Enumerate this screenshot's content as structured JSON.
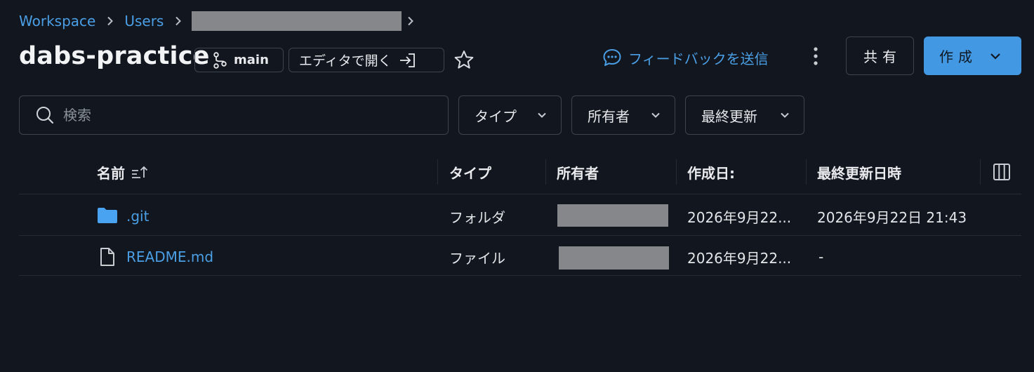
{
  "breadcrumb": {
    "items": [
      "Workspace",
      "Users"
    ]
  },
  "header": {
    "title": "dabs-practice",
    "branch": "main",
    "open_editor": "エディタで開く",
    "feedback": "フィードバックを送信",
    "share": "共有",
    "create": "作成"
  },
  "filters": {
    "search_placeholder": "検索",
    "type": "タイプ",
    "owner": "所有者",
    "last_modified": "最終更新"
  },
  "table": {
    "columns": {
      "name": "名前",
      "type": "タイプ",
      "owner": "所有者",
      "created": "作成日:",
      "modified": "最終更新日時"
    },
    "rows": [
      {
        "icon": "folder-icon",
        "name": ".git",
        "type": "フォルダ",
        "created": "2026年9月22...",
        "modified": "2026年9月22日 21:43"
      },
      {
        "icon": "file-icon",
        "name": "README.md",
        "type": "ファイル",
        "created": "2026年9月22...",
        "modified": "-"
      }
    ]
  },
  "colors": {
    "background": "#12161e",
    "accent": "#4a9fe6",
    "primary_button": "#4398e4",
    "border": "#3e444d",
    "redaction": "#86878b"
  }
}
